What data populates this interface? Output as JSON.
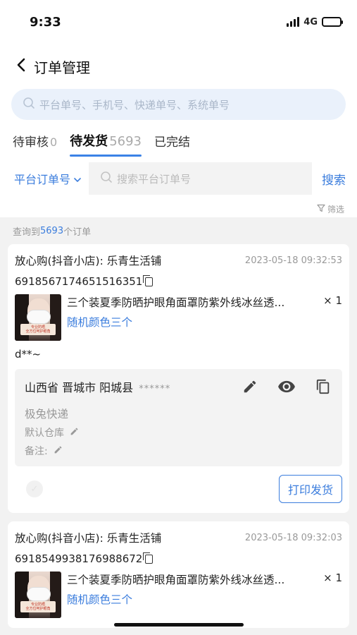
{
  "status_bar": {
    "time": "9:33",
    "network": "4G"
  },
  "nav": {
    "title": "订单管理"
  },
  "search": {
    "placeholder": "平台单号、手机号、快递单号、系统单号"
  },
  "tabs": [
    {
      "label": "待审核",
      "count": "0"
    },
    {
      "label": "待发货",
      "count": "5693"
    },
    {
      "label": "已完结",
      "count": ""
    }
  ],
  "filter": {
    "select_label": "平台订单号",
    "placeholder": "搜索平台订单号",
    "search_button": "搜索",
    "filter_link": "筛选"
  },
  "result": {
    "prefix": "查询到",
    "count": "5693",
    "suffix": "个订单"
  },
  "orders": [
    {
      "shop": "放心购(抖音小店): 乐青生活铺",
      "time": "2023-05-18 09:32:53",
      "order_no": "6918567174651516351",
      "product": "三个装夏季防晒护眼角面罩防紫外线冰丝透...",
      "quantity": "× 1",
      "spec": "随机颜色三个",
      "thumb_text_1": "专业防晒",
      "thumb_text_2": "全方位呵护眼角",
      "buyer": "d**~",
      "address": "山西省 晋城市 阳城县",
      "address_mask": "******",
      "courier": "极兔快递",
      "warehouse": "默认仓库",
      "note": "备注:",
      "print_button": "打印发货"
    },
    {
      "shop": "放心购(抖音小店): 乐青生活铺",
      "time": "2023-05-18 09:32:03",
      "order_no": "6918549938176988672",
      "product": "三个装夏季防晒护眼角面罩防紫外线冰丝透...",
      "quantity": "× 1",
      "spec": "随机颜色三个",
      "thumb_text_1": "专业防晒",
      "thumb_text_2": "全方位呵护眼角"
    }
  ]
}
